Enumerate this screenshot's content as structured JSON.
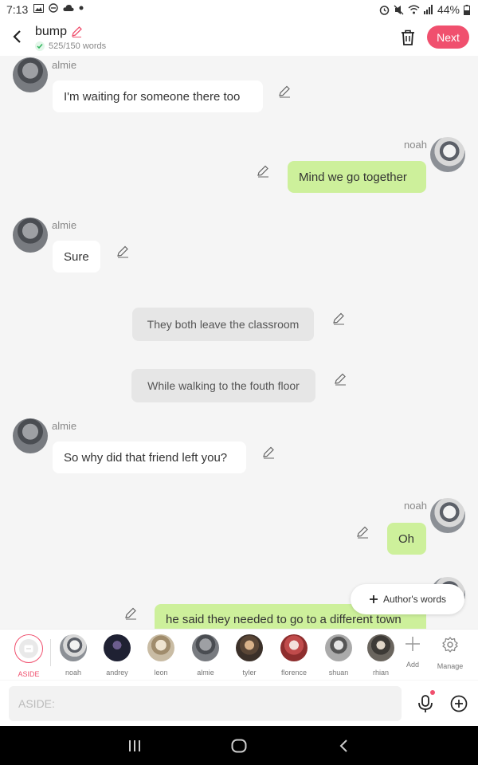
{
  "status_bar": {
    "time": "7:13",
    "battery": "44%"
  },
  "header": {
    "title": "bump",
    "word_count": "525/150 words",
    "next_label": "Next"
  },
  "messages": [
    {
      "speaker": "almie",
      "text": "I'm waiting for someone there too",
      "side": "left"
    },
    {
      "speaker": "noah",
      "text": "Mind we go together",
      "side": "right"
    },
    {
      "speaker": "almie",
      "text": "Sure",
      "side": "left"
    },
    {
      "speaker": "",
      "text": "They both leave the classroom",
      "side": "narration"
    },
    {
      "speaker": "",
      "text": "While walking to the fouth floor",
      "side": "narration"
    },
    {
      "speaker": "almie",
      "text": "So why did that friend left you?",
      "side": "left"
    },
    {
      "speaker": "noah",
      "text": "Oh",
      "side": "right"
    },
    {
      "speaker": "noah",
      "text": "he said they needed to go to a different town",
      "side": "right"
    }
  ],
  "author_words_label": "Author's words",
  "characters": [
    {
      "label": "ASIDE",
      "color": "#f0506e"
    },
    {
      "label": "noah",
      "color": "#c9cdd2"
    },
    {
      "label": "andrey",
      "color": "#2a2c3e"
    },
    {
      "label": "leon",
      "color": "#b7a892"
    },
    {
      "label": "almie",
      "color": "#8f9297"
    },
    {
      "label": "tyler",
      "color": "#6b5a4c"
    },
    {
      "label": "florence",
      "color": "#b04a4a"
    },
    {
      "label": "shuan",
      "color": "#a8a8a8"
    },
    {
      "label": "rhian",
      "color": "#5c5852"
    }
  ],
  "tools": {
    "add_label": "Add",
    "manage_label": "Manage"
  },
  "input": {
    "placeholder": "ASIDE:"
  },
  "colors": {
    "accent": "#f0506e",
    "right_bubble": "#cdf09b",
    "narration_bubble": "#e6e6e6"
  }
}
